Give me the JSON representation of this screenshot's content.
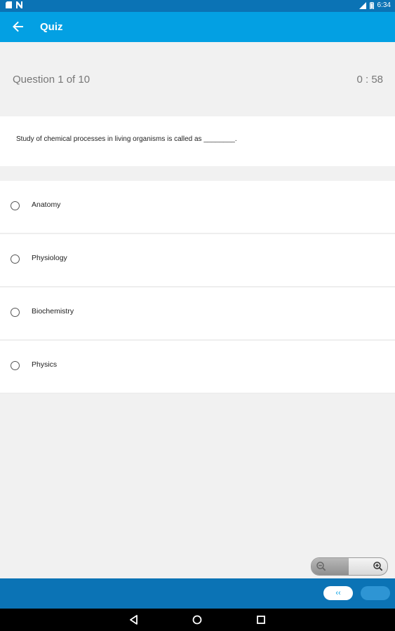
{
  "status_bar": {
    "time": "6:34"
  },
  "app_bar": {
    "title": "Quiz"
  },
  "question_header": {
    "counter": "Question 1 of  10",
    "timer": "0 : 58"
  },
  "question": {
    "text": "Study of chemical processes in living organisms is called as ________."
  },
  "options": [
    {
      "label": "Anatomy"
    },
    {
      "label": "Physiology"
    },
    {
      "label": "Biochemistry"
    },
    {
      "label": "Physics"
    }
  ],
  "navigation": {
    "previous_label": "‹‹"
  },
  "colors": {
    "app_bar": "#03a0e3",
    "status_bar": "#0b73b5",
    "bottom_bar": "#0b73b5"
  }
}
